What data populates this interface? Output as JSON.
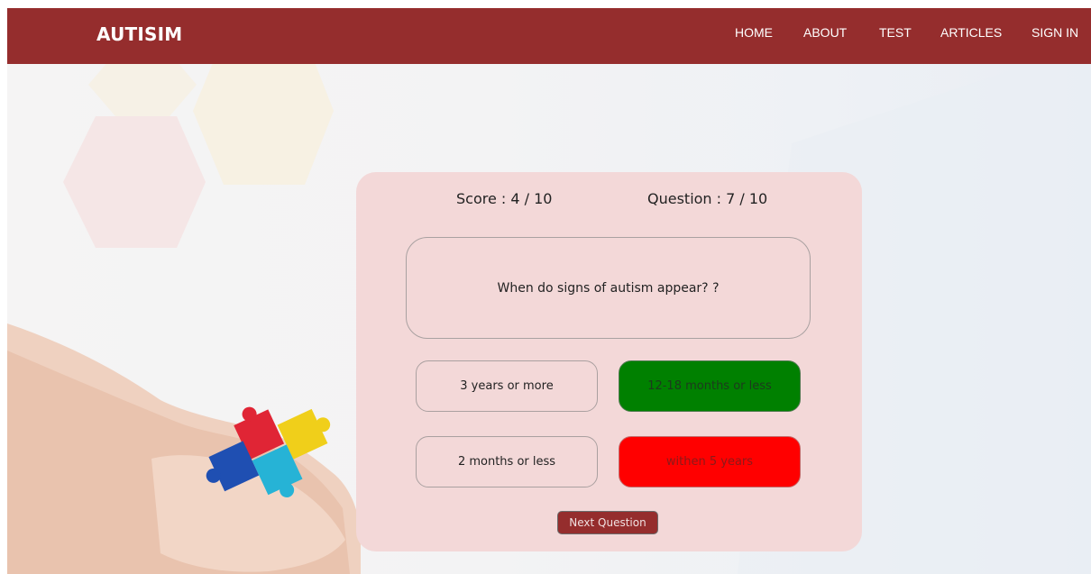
{
  "navbar": {
    "brand": "AUTISIM",
    "links": [
      "HOME",
      "ABOUT",
      "TEST",
      "ARTICLES",
      "SIGN IN"
    ]
  },
  "quiz": {
    "score_text": "Score : 4 / 10",
    "question_count_text": "Question : 7 / 10",
    "question": "When do signs of autism appear? ?",
    "answers": [
      {
        "label": "3 years or more",
        "state": "default"
      },
      {
        "label": "12-18 months or less",
        "state": "correct"
      },
      {
        "label": "2 months or less",
        "state": "default"
      },
      {
        "label": "withen 5 years",
        "state": "wrong"
      }
    ],
    "next_label": "Next Question"
  },
  "colors": {
    "navbar": "#952d2d",
    "card": "#f3d8d8",
    "correct": "#008000",
    "wrong": "#ff0000"
  }
}
